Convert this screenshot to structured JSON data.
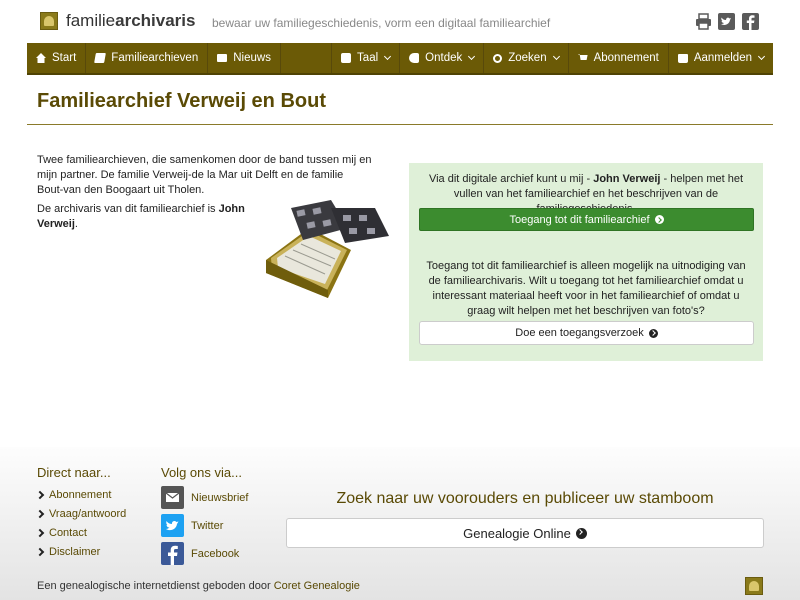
{
  "header": {
    "logo_light": "familie",
    "logo_bold": "archivaris",
    "tagline": "bewaar uw familiegeschiedenis, vorm een digitaal familiearchief"
  },
  "nav": {
    "start": "Start",
    "archives": "Familiearchieven",
    "news": "Nieuws",
    "language": "Taal",
    "discover": "Ontdek",
    "search": "Zoeken",
    "subscription": "Abonnement",
    "login": "Aanmelden"
  },
  "page": {
    "title": "Familiearchief Verweij en Bout",
    "intro": "Twee familiearchieven, die samenkomen door de band tussen mij en mijn partner. De familie Verweij-de la Mar uit Delft en de familie Bout-van den Boogaart uit Tholen.",
    "curator_prefix": "De archivaris van dit familiearchief is ",
    "curator_name": "John Verweij",
    "curator_suffix": "."
  },
  "panel": {
    "text1_prefix": "Via dit digitale archief kunt u mij - ",
    "text1_name": "John Verweij",
    "text1_suffix": " - helpen met het vullen van het familiearchief en het beschrijven van de familiegeschiedenis.",
    "access_button": "Toegang tot dit familiearchief",
    "text2": "Toegang tot dit familiearchief is alleen mogelijk na uitnodiging van de familiearchivaris. Wilt u toegang tot het familiearchief omdat u interessant materiaal heeft voor in het familiearchief of omdat u graag wilt helpen met het beschrijven van foto's?",
    "request_button": "Doe een toegangsverzoek"
  },
  "footer": {
    "direct_heading": "Direct naar...",
    "links": [
      "Abonnement",
      "Vraag/antwoord",
      "Contact",
      "Disclaimer"
    ],
    "follow_heading": "Volg ons via...",
    "social": [
      "Nieuwsbrief",
      "Twitter",
      "Facebook"
    ],
    "search_heading": "Zoek naar uw voorouders en publiceer uw stamboom",
    "genealogy_button": "Genealogie Online",
    "credit_prefix": "Een genealogische internetdienst geboden door ",
    "credit_link": "Coret Genealogie"
  }
}
